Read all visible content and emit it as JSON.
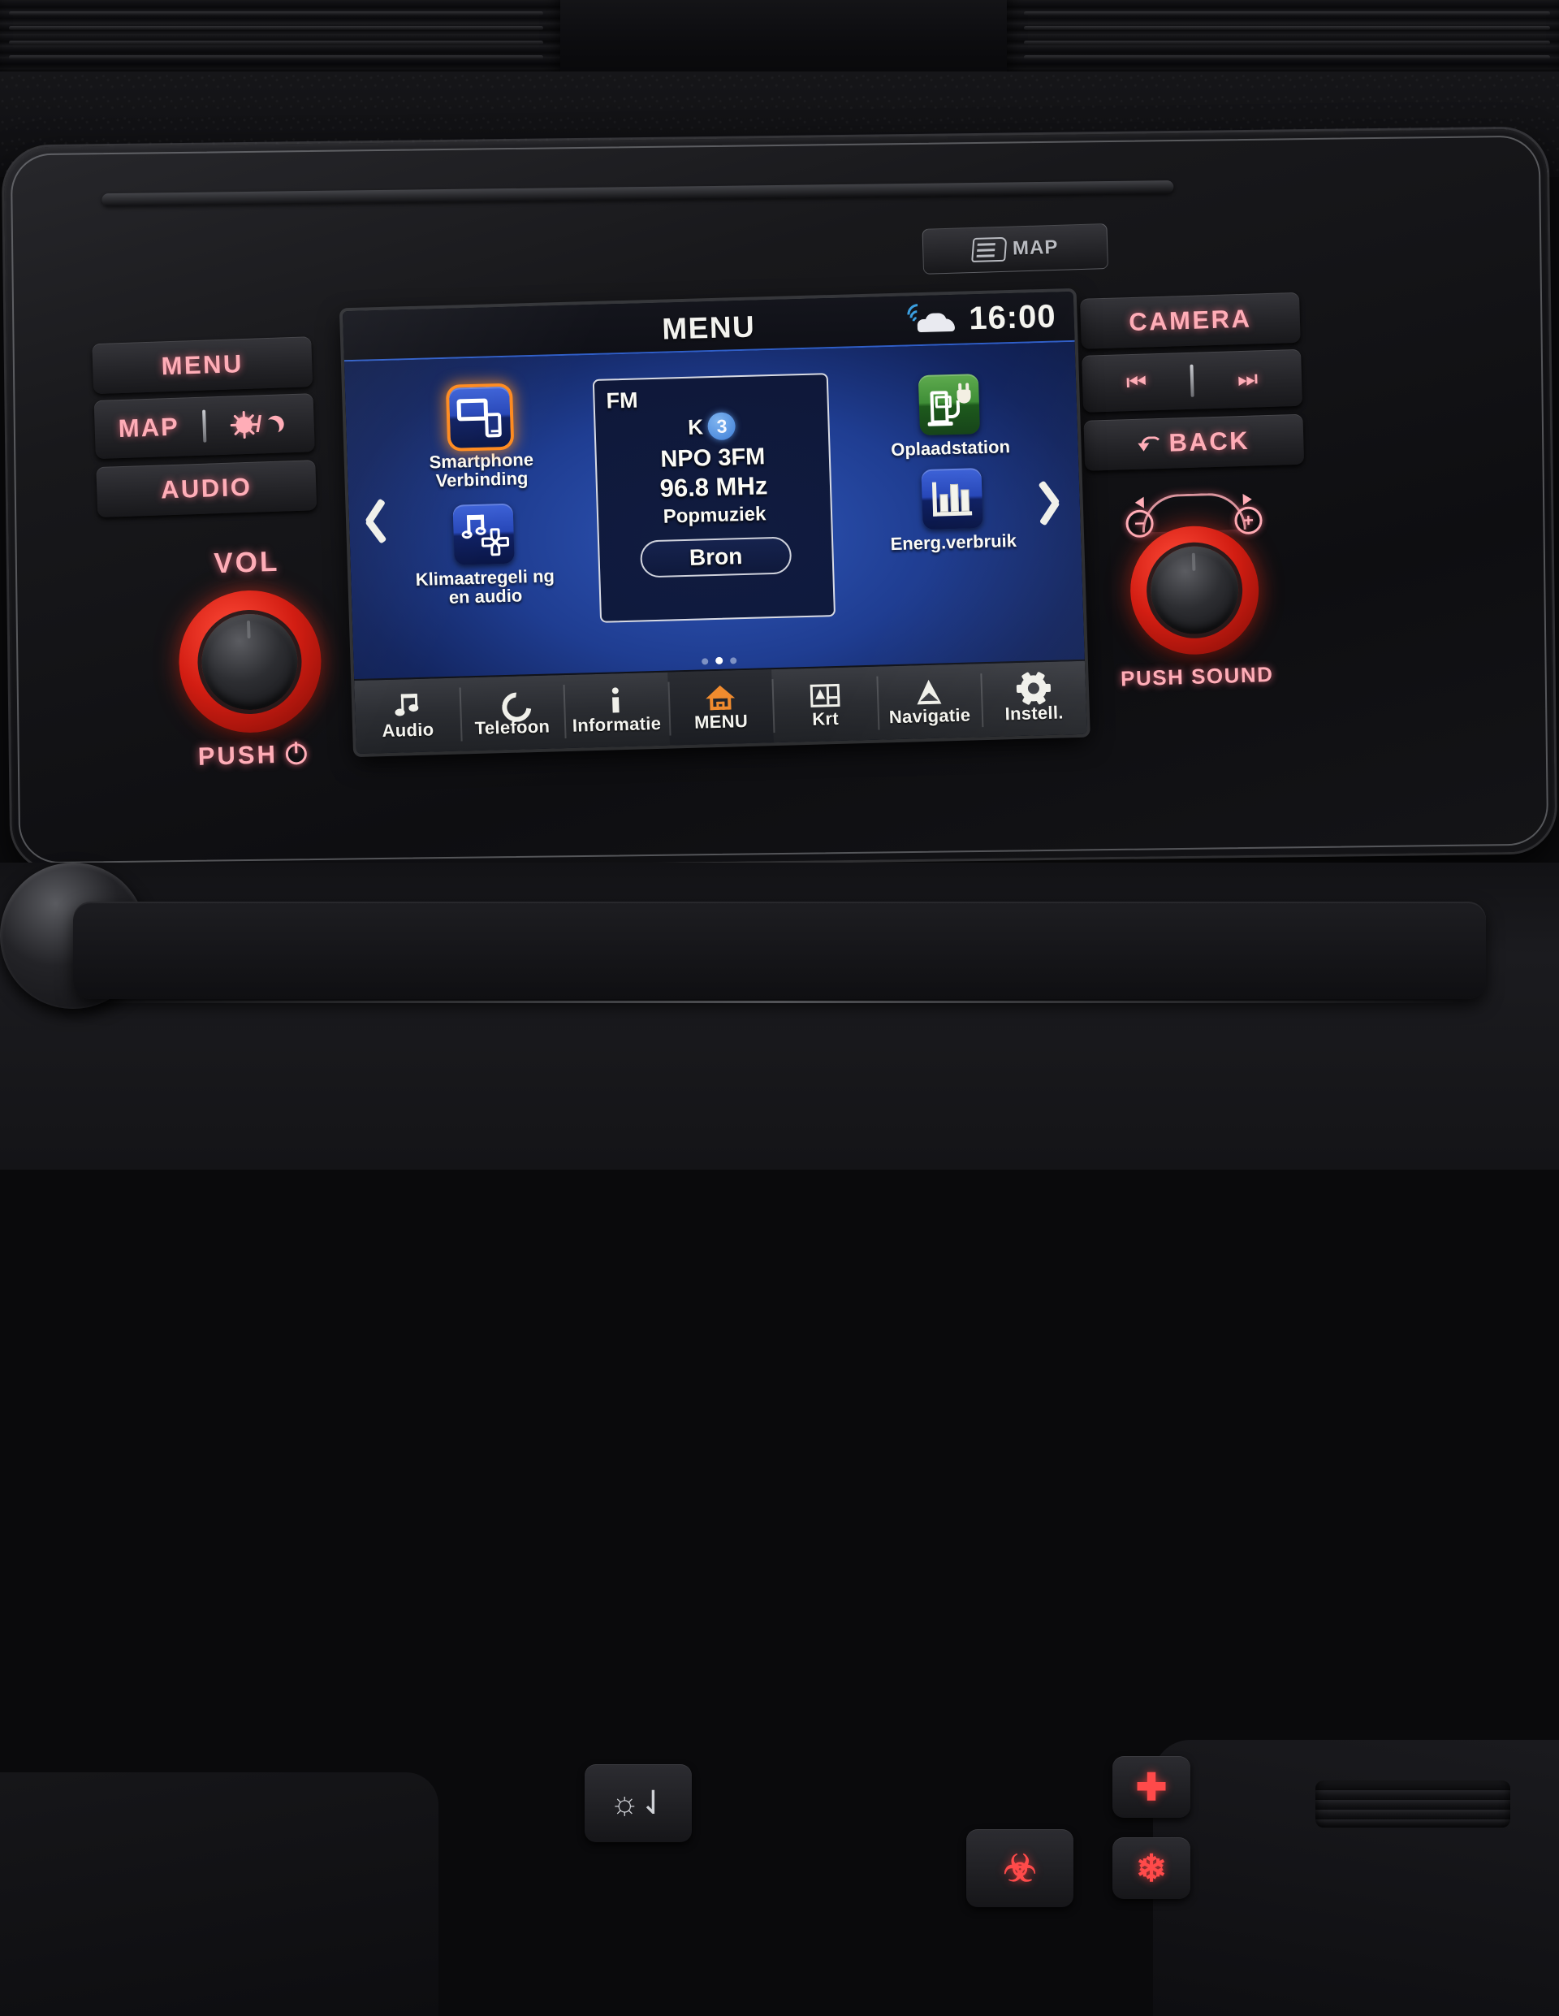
{
  "hardware": {
    "left_cluster": {
      "menu_label": "MENU",
      "map_label": "MAP",
      "brightness_icon": "sun-moon-icon",
      "audio_label": "AUDIO",
      "vol_label": "VOL",
      "push_label": "PUSH",
      "power_icon": "power-icon"
    },
    "right_cluster": {
      "camera_label": "CAMERA",
      "prev_track_icon": "previous-track-icon",
      "next_track_icon": "next-track-icon",
      "back_label": "BACK",
      "back_icon": "back-arrow-icon",
      "zoom_out_label": "−",
      "zoom_in_label": "+",
      "push_sound_label": "PUSH SOUND"
    },
    "sd_slot": {
      "label": "MAP",
      "icon": "sd-card-icon"
    }
  },
  "screen": {
    "status": {
      "title": "MENU",
      "clock": "16:00",
      "connectivity_icon": "car-wifi-icon"
    },
    "nav_arrows": {
      "prev_icon": "chevron-left-icon",
      "next_icon": "chevron-right-icon"
    },
    "tiles_left": [
      {
        "label": "Smartphone Verbinding",
        "icon": "screen-phone-icon",
        "color": "#2747b8",
        "selected": true
      },
      {
        "label": "Klimaatregeli ng en audio",
        "icon": "music-fan-icon",
        "color": "#2747b8",
        "selected": false
      }
    ],
    "tiles_right": [
      {
        "label": "Oplaadstation",
        "icon": "charging-station-icon",
        "color": "#3f8e37",
        "selected": false
      },
      {
        "label": "Energ.verbruik",
        "icon": "bar-chart-icon",
        "color": "#2747b8",
        "selected": false
      }
    ],
    "radio_card": {
      "band": "FM",
      "preset_letter": "K",
      "preset_number": "3",
      "station": "NPO 3FM",
      "frequency": "96.8 MHz",
      "genre": "Popmuziek",
      "source_button": "Bron"
    },
    "pagination": {
      "total": 3,
      "active_index": 1
    },
    "bottom_nav": [
      {
        "label": "Audio",
        "icon": "music-note-icon",
        "active": false
      },
      {
        "label": "Telefoon",
        "icon": "phone-icon",
        "active": false
      },
      {
        "label": "Informatie",
        "icon": "info-icon",
        "active": false
      },
      {
        "label": "MENU",
        "icon": "home-icon",
        "active": true
      },
      {
        "label": "Krt",
        "icon": "map-icon",
        "active": false
      },
      {
        "label": "Navigatie",
        "icon": "navigation-arrow-icon",
        "active": false
      },
      {
        "label": "Instell.",
        "icon": "gear-icon",
        "active": false
      }
    ]
  },
  "colors": {
    "accent_orange": "#ff8a1e",
    "backlight_pink": "#ffadb7",
    "knob_red": "#d21d12",
    "screen_blue": "#2747b8",
    "tile_green": "#3f8e37",
    "title_underline": "#2f5ec8"
  }
}
